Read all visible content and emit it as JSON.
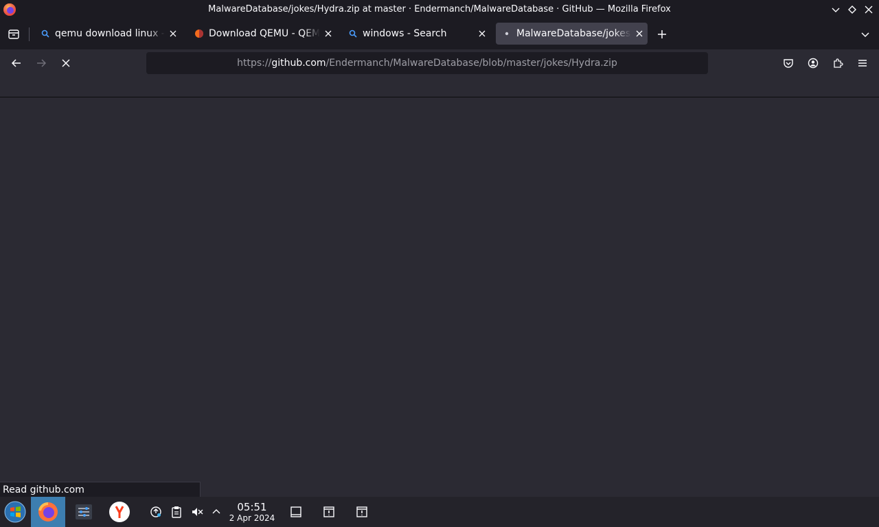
{
  "window": {
    "title": "MalwareDatabase/jokes/Hydra.zip at master · Endermanch/MalwareDatabase · GitHub — Mozilla Firefox"
  },
  "tabs": [
    {
      "label": "qemu download linux - S",
      "icon": "search-icon"
    },
    {
      "label": "Download QEMU - QEMU",
      "icon": "qemu-favicon"
    },
    {
      "label": "windows - Search",
      "icon": "search-icon"
    },
    {
      "label": "MalwareDatabase/jokes/Hydra.zip",
      "icon": "loading-dot-icon",
      "active": true
    }
  ],
  "urlbar": {
    "scheme": "https://",
    "host": "github.com",
    "path": "/Endermanch/MalwareDatabase/blob/master/jokes/Hydra.zip"
  },
  "status": {
    "text": "Read github.com"
  },
  "taskbar": {
    "time": "05:51",
    "date": "2 Apr 2024"
  },
  "colors": {
    "chrome_dark": "#1c1b22",
    "content_bg": "#2b2a33",
    "active_tab": "#42414d",
    "taskbar_active": "#3d7eb0"
  }
}
